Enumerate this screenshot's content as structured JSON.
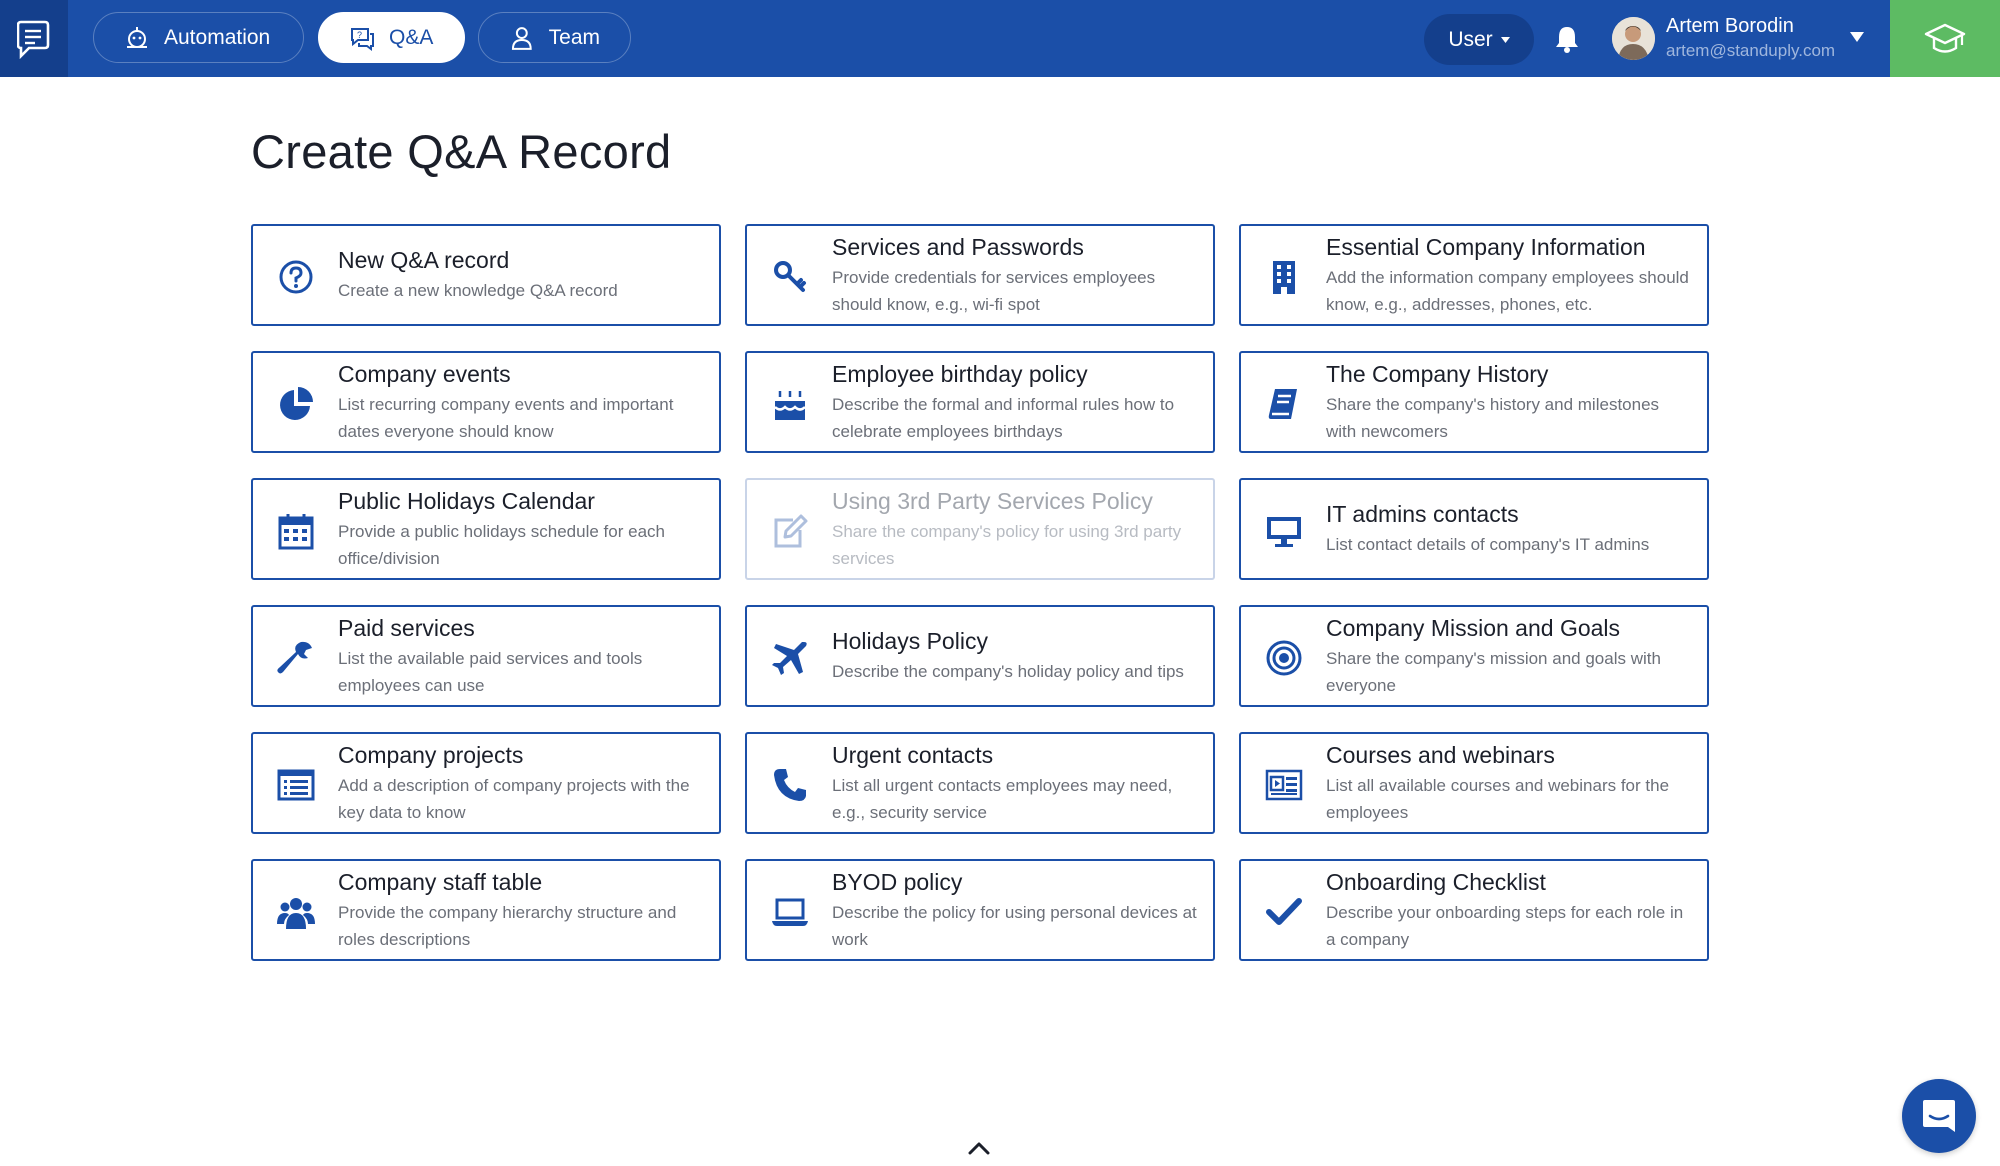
{
  "topbar": {
    "nav": [
      {
        "label": "Automation",
        "icon": "robot-icon",
        "active": false
      },
      {
        "label": "Q&A",
        "icon": "chat-question-icon",
        "active": true
      },
      {
        "label": "Team",
        "icon": "person-icon",
        "active": false
      }
    ],
    "role_select": "User",
    "user": {
      "name": "Artem Borodin",
      "email": "artem@standuply.com"
    }
  },
  "page": {
    "title": "Create Q&A Record"
  },
  "cards": [
    {
      "title": "New Q&A record",
      "desc": "Create a new knowledge Q&A record",
      "icon": "question-circle-icon",
      "disabled": false
    },
    {
      "title": "Services and Passwords",
      "desc": "Provide credentials for services employees should know, e.g., wi-fi spot",
      "icon": "key-icon",
      "disabled": false
    },
    {
      "title": "Essential Company Information",
      "desc": "Add the information company employees should know, e.g., addresses, phones, etc.",
      "icon": "building-icon",
      "disabled": false
    },
    {
      "title": "Company events",
      "desc": "List recurring company events and important dates everyone should know",
      "icon": "pie-chart-icon",
      "disabled": false
    },
    {
      "title": "Employee birthday policy",
      "desc": "Describe the formal and informal rules how to celebrate employees birthdays",
      "icon": "birthday-cake-icon",
      "disabled": false
    },
    {
      "title": "The Company History",
      "desc": "Share the company's history and milestones with newcomers",
      "icon": "book-icon",
      "disabled": false
    },
    {
      "title": "Public Holidays Calendar",
      "desc": "Provide a public holidays schedule for each office/division",
      "icon": "calendar-icon",
      "disabled": false
    },
    {
      "title": "Using 3rd Party Services Policy",
      "desc": "Share the company's policy for using 3rd party services",
      "icon": "edit-icon",
      "disabled": true
    },
    {
      "title": "IT admins contacts",
      "desc": "List contact details of company's IT admins",
      "icon": "monitor-icon",
      "disabled": false
    },
    {
      "title": "Paid services",
      "desc": "List the available paid services and tools employees can use",
      "icon": "wrench-icon",
      "disabled": false
    },
    {
      "title": "Holidays Policy",
      "desc": "Describe the company's holiday policy and tips",
      "icon": "plane-icon",
      "disabled": false
    },
    {
      "title": "Company Mission and Goals",
      "desc": "Share the company's mission and goals with everyone",
      "icon": "target-icon",
      "disabled": false
    },
    {
      "title": "Company projects",
      "desc": "Add a description of company projects with the key data to know",
      "icon": "list-icon",
      "disabled": false
    },
    {
      "title": "Urgent contacts",
      "desc": "List all urgent contacts employees may need, e.g., security service",
      "icon": "phone-icon",
      "disabled": false
    },
    {
      "title": "Courses and webinars",
      "desc": "List all available courses and webinars for the employees",
      "icon": "video-list-icon",
      "disabled": false
    },
    {
      "title": "Company staff table",
      "desc": "Provide the company hierarchy structure and roles descriptions",
      "icon": "users-icon",
      "disabled": false
    },
    {
      "title": "BYOD policy",
      "desc": "Describe the policy for using personal devices at work",
      "icon": "laptop-icon",
      "disabled": false
    },
    {
      "title": "Onboarding Checklist",
      "desc": "Describe your onboarding steps for each role in a company",
      "icon": "checkmark-icon",
      "disabled": false
    }
  ],
  "colors": {
    "brand": "#1b4fa8",
    "nav_dark": "#143f8c",
    "accent_green": "#5dbb63",
    "disabled_border": "#c9d4e8"
  }
}
